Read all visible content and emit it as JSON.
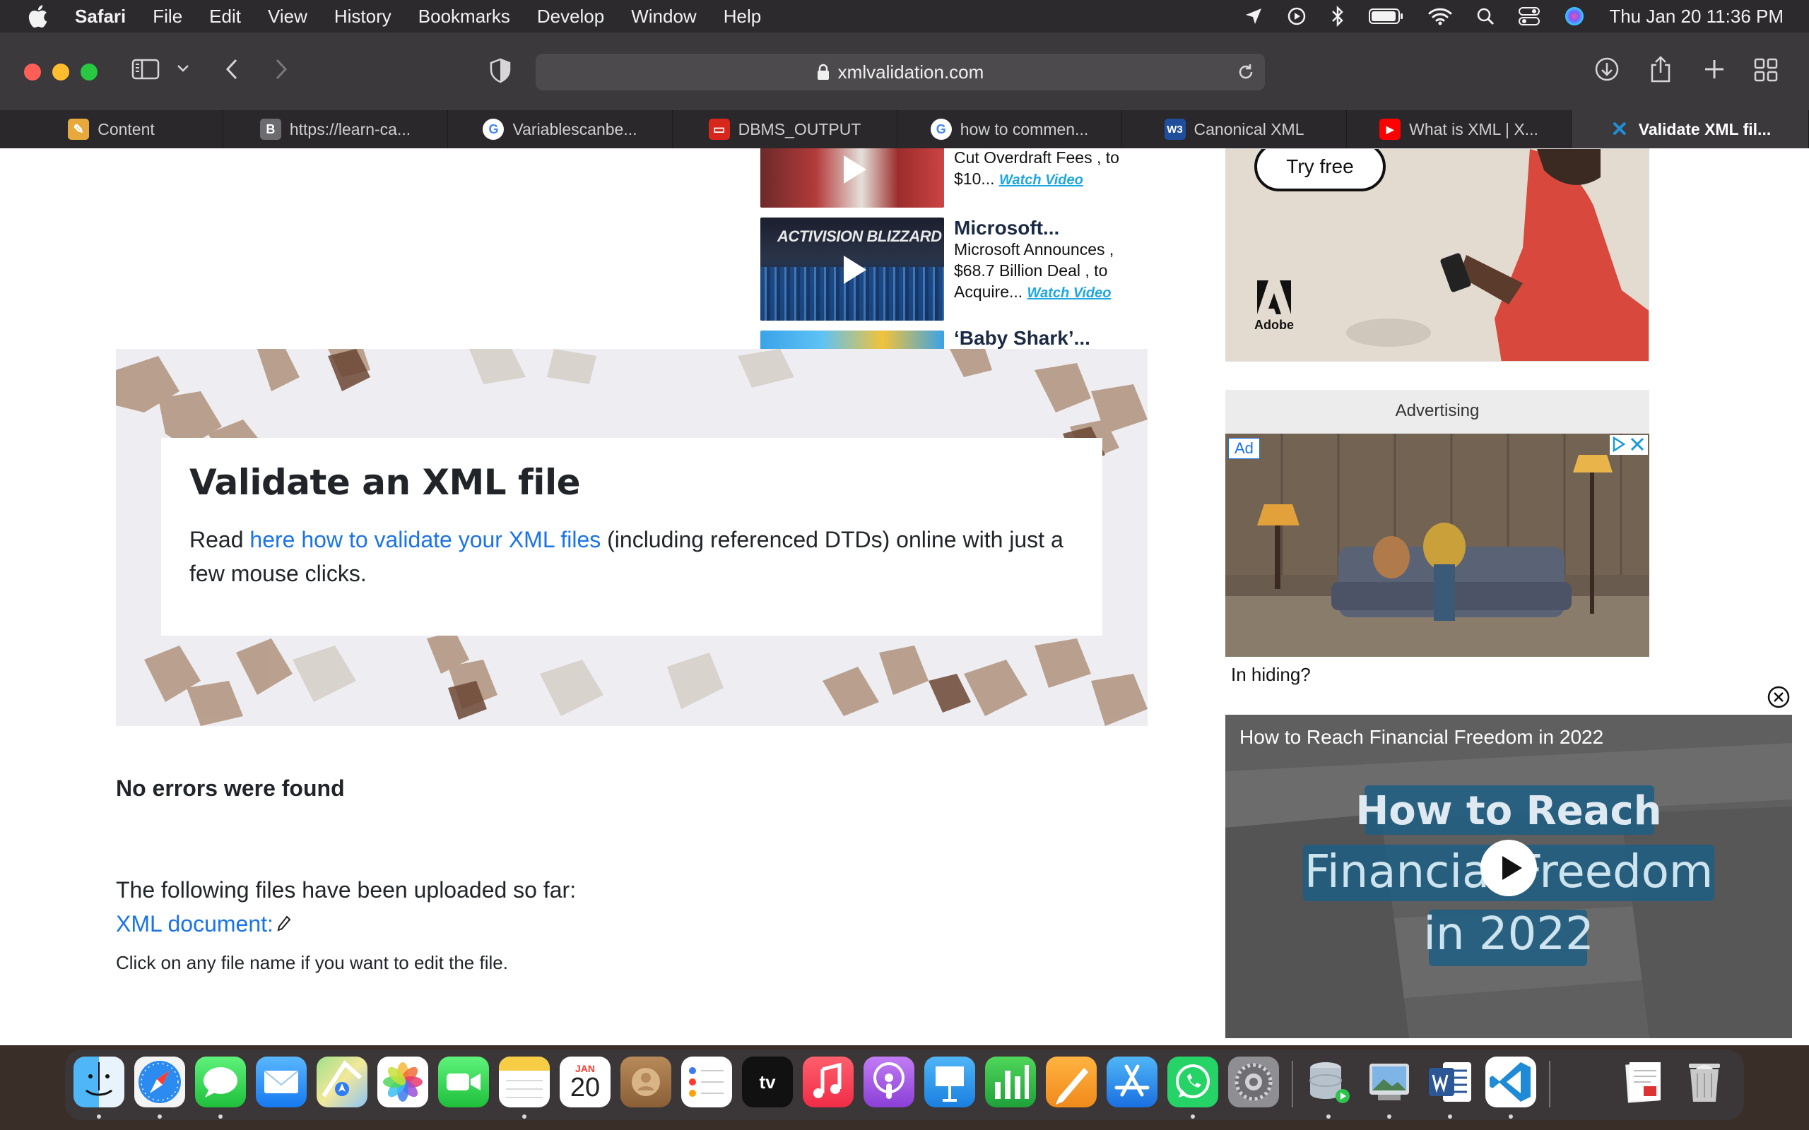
{
  "menubar": {
    "app_name": "Safari",
    "items": [
      "File",
      "Edit",
      "View",
      "History",
      "Bookmarks",
      "Develop",
      "Window",
      "Help"
    ],
    "clock": "Thu Jan 20  11:36 PM"
  },
  "toolbar": {
    "url": "xmlvalidation.com"
  },
  "tabs": [
    {
      "label": "Content",
      "fav_color": "#e7a93b",
      "fav_text": "✎"
    },
    {
      "label": "https://learn-ca...",
      "fav_color": "#6b6b70",
      "fav_text": "B"
    },
    {
      "label": "Variablescanbe...",
      "fav_color": "#ffffff",
      "fav_text": "G"
    },
    {
      "label": "DBMS_OUTPUT",
      "fav_color": "#d7261b",
      "fav_text": "▭"
    },
    {
      "label": "how to commen...",
      "fav_color": "#ffffff",
      "fav_text": "G"
    },
    {
      "label": "Canonical XML",
      "fav_color": "#1f4f9c",
      "fav_text": "W3"
    },
    {
      "label": "What is XML | X...",
      "fav_color": "#ff0000",
      "fav_text": "▶"
    },
    {
      "label": "Validate XML fil...",
      "fav_color": "#1f8ed6",
      "fav_text": "✕"
    }
  ],
  "news": [
    {
      "title": "",
      "text": "Cut Overdraft Fees , to $10...",
      "watch": "Watch Video"
    },
    {
      "title": "Microsoft...",
      "text": "Microsoft Announces , $68.7 Billion Deal , to Acquire...",
      "watch": "Watch Video"
    },
    {
      "title": "‘Baby Shark’...",
      "text": "",
      "watch": ""
    }
  ],
  "hero": {
    "title": "Validate an XML file",
    "text_before": "Read ",
    "link": "here how to validate your XML files",
    "text_after": " (including referenced DTDs) online with just a few mouse clicks."
  },
  "result": {
    "status": "No errors were found",
    "uploaded_label": "The following files have been uploaded so far:",
    "file_link": "XML document:",
    "hint": "Click on any file name if you want to edit the file."
  },
  "ads": {
    "adobe_button": "Try free",
    "adobe_name": "Adobe",
    "advertising_label": "Advertising",
    "ad_badge": "Ad",
    "caption": "In hiding?",
    "news_thumb_text": "ACTIVISION BLIZZARD"
  },
  "video": {
    "title": "How to Reach Financial Freedom in 2022",
    "line1": "How to Reach",
    "line2": "Financial Freedom",
    "line3": "in 2022"
  },
  "dock": {
    "calendar_month": "JAN",
    "calendar_day": "20",
    "tv_label": "tv"
  }
}
